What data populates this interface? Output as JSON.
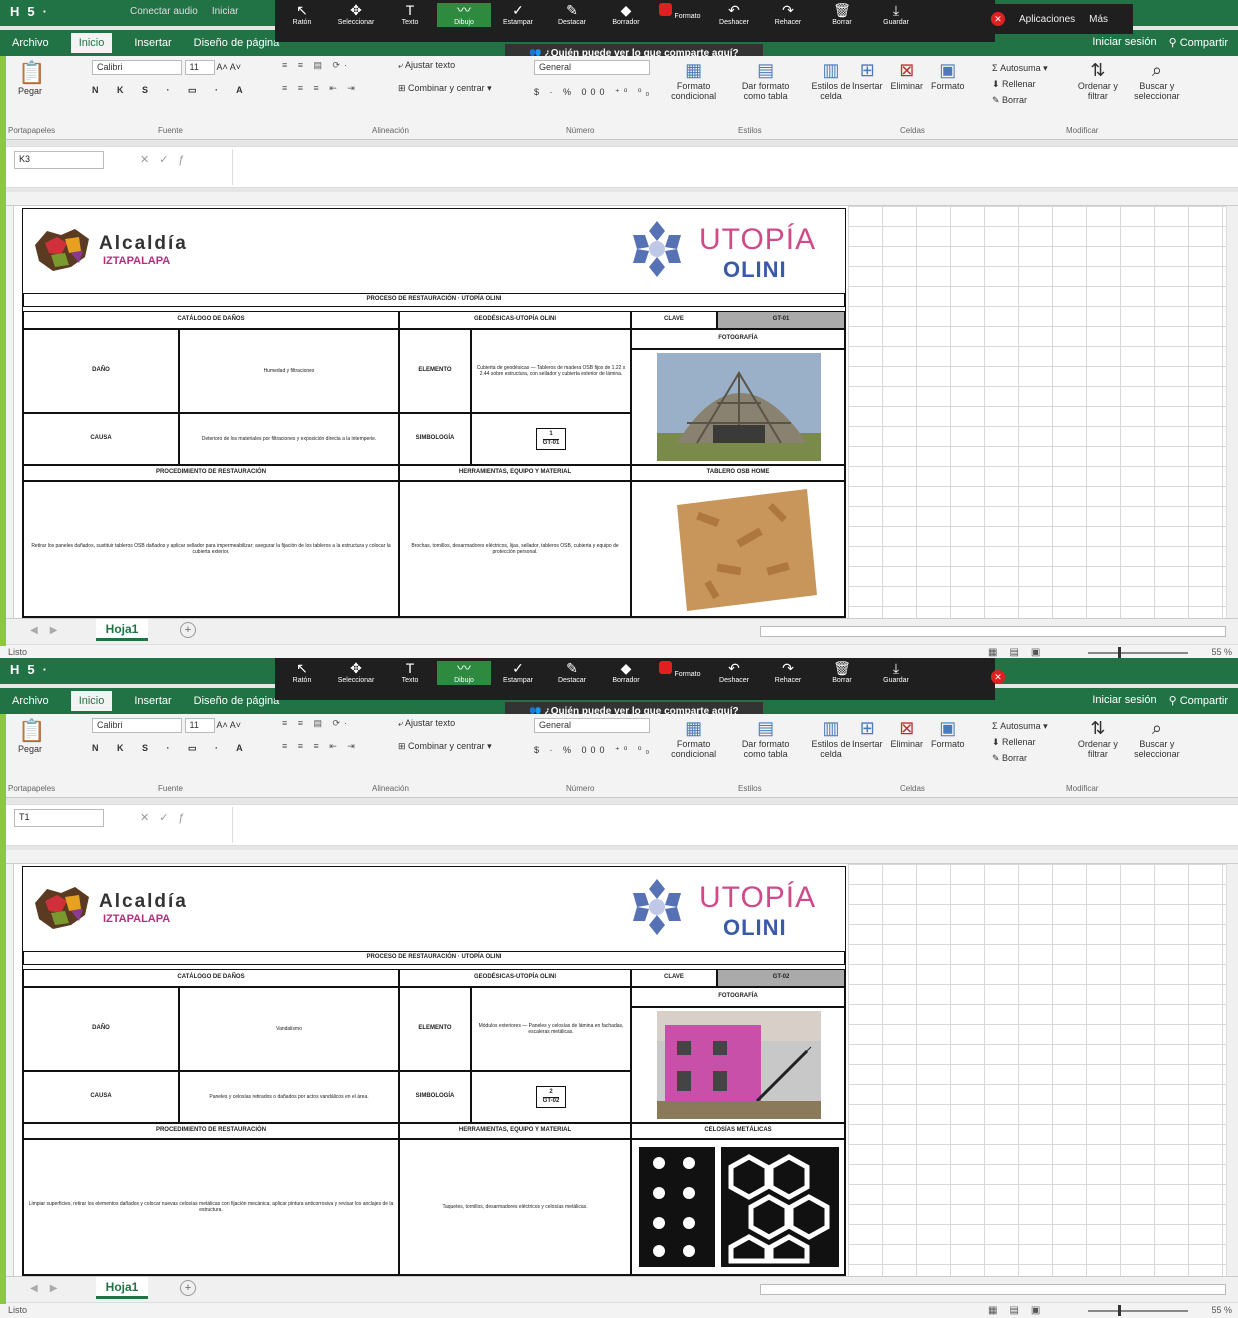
{
  "windows": [
    {
      "qat": [
        "H",
        "5",
        "·"
      ],
      "zoom_left": [
        "Conectar audio",
        "Iniciar"
      ],
      "zoom_buttons": [
        {
          "icon": "↖",
          "label": "Ratón",
          "hl": false
        },
        {
          "icon": "✥",
          "label": "Seleccionar",
          "hl": false
        },
        {
          "icon": "T",
          "label": "Texto",
          "hl": false
        },
        {
          "icon": "〰",
          "label": "Dibujo",
          "hl": true
        },
        {
          "icon": "✓",
          "label": "Estampar",
          "hl": false
        },
        {
          "icon": "✎",
          "label": "Destacar",
          "hl": false
        },
        {
          "icon": "◆",
          "label": "Borrador",
          "hl": false
        },
        {
          "icon": "■",
          "label": "Formato",
          "hl": false
        },
        {
          "icon": "↶",
          "label": "Deshacer",
          "hl": false
        },
        {
          "icon": "↷",
          "label": "Rehacer",
          "hl": false
        },
        {
          "icon": "🗑",
          "label": "Borrar",
          "hl": false
        },
        {
          "icon": "⤓",
          "label": "Guardar",
          "hl": false
        }
      ],
      "zoom_right": [
        "Aplicaciones",
        "Más"
      ],
      "share": "¿Quién puede ver lo que comparte aquí?",
      "tabs": [
        "Archivo",
        "Inicio",
        "Insertar",
        "Diseño de página"
      ],
      "active_tab": "Inicio",
      "right_tabs": [
        "Iniciar sesión",
        "Compartir"
      ],
      "ribbon": {
        "paste": "Pegar",
        "clipboard": "Portapapeles",
        "font_name": "Calibri",
        "font_size": "11",
        "font_group": "Fuente",
        "wrap": "Ajustar texto",
        "merge": "Combinar y centrar",
        "align_group": "Alineación",
        "num_format": "General",
        "num_group": "Número",
        "styles": [
          "Formato condicional",
          "Dar formato como tabla",
          "Estilos de celda"
        ],
        "styles_group": "Estilos",
        "cells": [
          "Insertar",
          "Eliminar",
          "Formato"
        ],
        "cells_group": "Celdas",
        "edit": [
          "Autosuma",
          "Rellenar",
          "Borrar"
        ],
        "sort": "Ordenar y filtrar",
        "find": "Buscar y seleccionar",
        "edit_group": "Modificar"
      },
      "namebox": "K3",
      "sheet_tab": "Hoja1",
      "status": "Listo",
      "zoom_pct": "55 %",
      "doc": {
        "alc": "Alcaldía",
        "izt": "IZTAPALAPA",
        "uto": "UTOPÍA",
        "oli": "OLINI",
        "title": "PROCESO DE RESTAURACIÓN · UTOPÍA OLINI",
        "catalogo": "CATÁLOGO DE DAÑOS",
        "geodesicas": "GEODÉSICAS-UTOPÍA OLINI",
        "clave": "CLAVE",
        "clave_val": "GT-01",
        "fotografia": "FOTOGRAFÍA",
        "dano": "DAÑO",
        "dano_val": "Humedad y filtraciones",
        "elemento": "ELEMENTO",
        "elemento_val": "Cubierta de geodésicas — Tableros de madera OSB fijos de 1.22 x 2.44 sobre estructura, con sellador y cubierta exterior de lámina.",
        "causa": "CAUSA",
        "causa_val": "Deterioro de los materiales por filtraciones y exposición directa a la intemperie.",
        "simbologia": "SIMBOLOGÍA",
        "simb_num": "1",
        "simb_code": "GT-01",
        "procedimiento": "PROCEDIMIENTO DE RESTAURACIÓN",
        "herramientas": "HERRAMIENTAS, EQUIPO Y MATERIAL",
        "material_photo": "TABLERO OSB HOME",
        "proc_text": "Retirar los paneles dañados, sustituir tableros OSB dañados y aplicar sellador para impermeabilizar; asegurar la fijación de los tableros a la estructura y colocar la cubierta exterior.",
        "herr_text": "Brochas, tornillos, desarmadores eléctricos, lijas, sellador, tableros OSB, cubierta y equipo de protección personal."
      }
    },
    {
      "qat": [
        "H",
        "5",
        "·"
      ],
      "zoom_left": [],
      "zoom_buttons": [
        {
          "icon": "↖",
          "label": "Ratón",
          "hl": false
        },
        {
          "icon": "✥",
          "label": "Seleccionar",
          "hl": false
        },
        {
          "icon": "T",
          "label": "Texto",
          "hl": false
        },
        {
          "icon": "〰",
          "label": "Dibujo",
          "hl": true
        },
        {
          "icon": "✓",
          "label": "Estampar",
          "hl": false
        },
        {
          "icon": "✎",
          "label": "Destacar",
          "hl": false
        },
        {
          "icon": "◆",
          "label": "Borrador",
          "hl": false
        },
        {
          "icon": "■",
          "label": "Formato",
          "hl": false
        },
        {
          "icon": "↶",
          "label": "Deshacer",
          "hl": false
        },
        {
          "icon": "↷",
          "label": "Rehacer",
          "hl": false
        },
        {
          "icon": "🗑",
          "label": "Borrar",
          "hl": false
        },
        {
          "icon": "⤓",
          "label": "Guardar",
          "hl": false
        }
      ],
      "zoom_right": [],
      "share": "¿Quién puede ver lo que comparte aquí?",
      "tabs": [
        "Archivo",
        "Inicio",
        "Insertar",
        "Diseño de página"
      ],
      "active_tab": "Inicio",
      "right_tabs": [
        "Iniciar sesión",
        "Compartir"
      ],
      "ribbon": {
        "paste": "Pegar",
        "clipboard": "Portapapeles",
        "font_name": "Calibri",
        "font_size": "11",
        "font_group": "Fuente",
        "wrap": "Ajustar texto",
        "merge": "Combinar y centrar",
        "align_group": "Alineación",
        "num_format": "General",
        "num_group": "Número",
        "styles": [
          "Formato condicional",
          "Dar formato como tabla",
          "Estilos de celda"
        ],
        "styles_group": "Estilos",
        "cells": [
          "Insertar",
          "Eliminar",
          "Formato"
        ],
        "cells_group": "Celdas",
        "edit": [
          "Autosuma",
          "Rellenar",
          "Borrar"
        ],
        "sort": "Ordenar y filtrar",
        "find": "Buscar y seleccionar",
        "edit_group": "Modificar"
      },
      "namebox": "T1",
      "sheet_tab": "Hoja1",
      "status": "Listo",
      "zoom_pct": "55 %",
      "doc": {
        "alc": "Alcaldía",
        "izt": "IZTAPALAPA",
        "uto": "UTOPÍA",
        "oli": "OLINI",
        "title": "PROCESO DE RESTAURACIÓN · UTOPÍA OLINI",
        "catalogo": "CATÁLOGO DE DAÑOS",
        "geodesicas": "GEODÉSICAS-UTOPÍA OLINI",
        "clave": "CLAVE",
        "clave_val": "GT-02",
        "fotografia": "FOTOGRAFÍA",
        "dano": "DAÑO",
        "dano_val": "Vandalismo",
        "elemento": "ELEMENTO",
        "elemento_val": "Módulos exteriores — Paneles y celosías de lámina en fachadas, escaleras metálicas.",
        "causa": "CAUSA",
        "causa_val": "Paneles y celosías retirados o dañados por actos vandálicos en el área.",
        "simbologia": "SIMBOLOGÍA",
        "simb_num": "2",
        "simb_code": "GT-02",
        "procedimiento": "PROCEDIMIENTO DE RESTAURACIÓN",
        "herramientas": "HERRAMIENTAS, EQUIPO Y MATERIAL",
        "material_photo": "CELOSÍAS METÁLICAS",
        "proc_text": "Limpiar superficies, retirar los elementos dañados y colocar nuevas celosías metálicas con fijación mecánica; aplicar pintura anticorrosiva y revisar los anclajes de la estructura.",
        "herr_text": "Taquetes, tornillos, desarmadores eléctricos y celosías metálicas."
      }
    }
  ]
}
